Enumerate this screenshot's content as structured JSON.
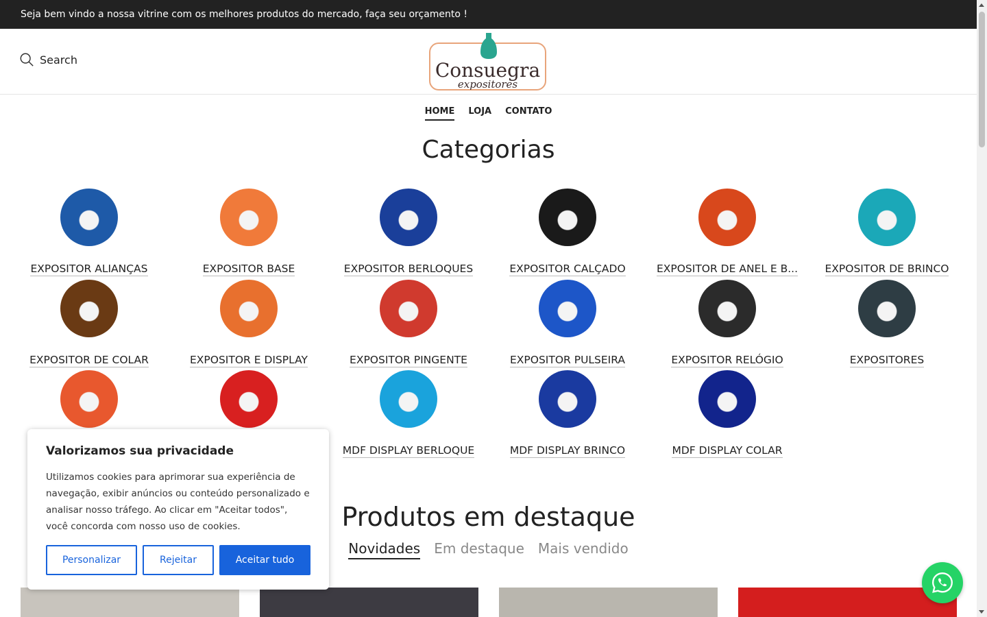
{
  "topbar": {
    "message": "Seja bem vindo a nossa vitrine com os melhores produtos do mercado, faça seu orçamento !"
  },
  "header": {
    "search_label": "Search",
    "logo": {
      "name": "Consuegra",
      "sub": "expositores"
    }
  },
  "nav": {
    "items": [
      "HOME",
      "LOJA",
      "CONTATO"
    ],
    "active": "HOME"
  },
  "categories": {
    "title": "Categorias",
    "items": [
      {
        "label": "EXPOSITOR ALIANÇAS",
        "color": "#1e5aa8"
      },
      {
        "label": "EXPOSITOR BASE",
        "color": "#f07a3a"
      },
      {
        "label": "EXPOSITOR BERLOQUES",
        "color": "#1a3f9a"
      },
      {
        "label": "EXPOSITOR CALÇADO",
        "color": "#1a1a1a"
      },
      {
        "label": "EXPOSITOR DE ANEL E B...",
        "color": "#d8481c"
      },
      {
        "label": "EXPOSITOR DE BRINCO",
        "color": "#1ba8b8"
      },
      {
        "label": "EXPOSITOR DE COLAR",
        "color": "#6a3a14"
      },
      {
        "label": "EXPOSITOR E DISPLAY",
        "color": "#e8702e"
      },
      {
        "label": "EXPOSITOR PINGENTE",
        "color": "#d03a2e"
      },
      {
        "label": "EXPOSITOR PULSEIRA",
        "color": "#1d56c8"
      },
      {
        "label": "EXPOSITOR RELÓGIO",
        "color": "#2b2b2b"
      },
      {
        "label": "EXPOSITORES",
        "color": "#2e3d44"
      },
      {
        "label": "",
        "color": "#e8582e"
      },
      {
        "label": "",
        "color": "#d82020"
      },
      {
        "label": "MDF DISPLAY BERLOQUE",
        "color": "#1aa3dc"
      },
      {
        "label": "MDF DISPLAY BRINCO",
        "color": "#1a3aa0"
      },
      {
        "label": "MDF DISPLAY COLAR",
        "color": "#12248c"
      }
    ]
  },
  "featured": {
    "title": "Produtos em destaque",
    "tabs": [
      "Novidades",
      "Em destaque",
      "Mais vendido"
    ],
    "active_tab": "Novidades",
    "products": [
      {
        "color": "#c8c4bd"
      },
      {
        "color": "#3d3b42"
      },
      {
        "color": "#b9b6ae"
      },
      {
        "color": "#d41e1e"
      }
    ]
  },
  "cookie": {
    "title": "Valorizamos sua privacidade",
    "text": "Utilizamos cookies para aprimorar sua experiência de navegação, exibir anúncios ou conteúdo personalizado e analisar nosso tráfego. Ao clicar em \"Aceitar todos\", você concorda com nosso uso de cookies.",
    "customize": "Personalizar",
    "reject": "Rejeitar",
    "accept": "Aceitar tudo",
    "accent": "#1863dc"
  },
  "whatsapp": {
    "icon": "whatsapp-icon",
    "color": "#25d366"
  }
}
